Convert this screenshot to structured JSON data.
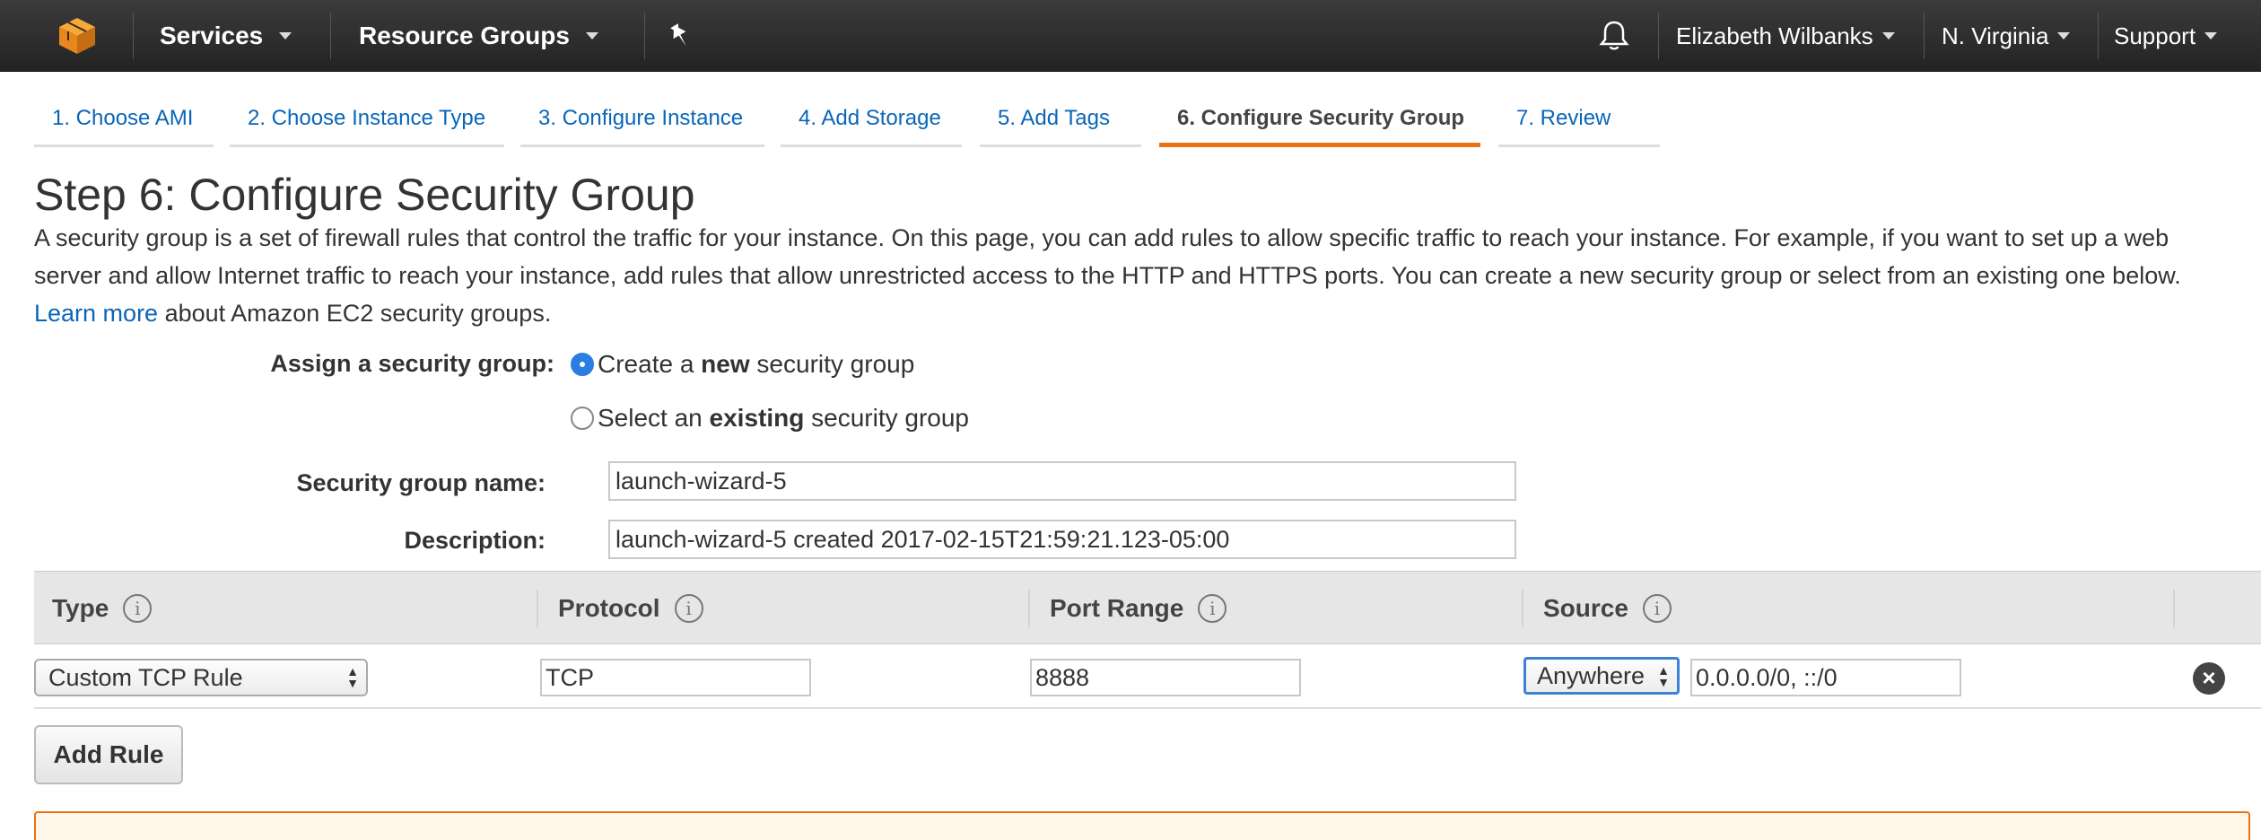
{
  "nav": {
    "services": "Services",
    "resource_groups": "Resource Groups",
    "user": "Elizabeth Wilbanks",
    "region": "N. Virginia",
    "support": "Support"
  },
  "tabs": [
    {
      "label": "1. Choose AMI"
    },
    {
      "label": "2. Choose Instance Type"
    },
    {
      "label": "3. Configure Instance"
    },
    {
      "label": "4. Add Storage"
    },
    {
      "label": "5. Add Tags"
    },
    {
      "label": "6. Configure Security Group",
      "active": true
    },
    {
      "label": "7. Review"
    }
  ],
  "page": {
    "title": "Step 6: Configure Security Group",
    "intro_text": "A security group is a set of firewall rules that control the traffic for your instance. On this page, you can add rules to allow specific traffic to reach your instance. For example, if you want to set up a web server and allow Internet traffic to reach your instance, add rules that allow unrestricted access to the HTTP and HTTPS ports. You can create a new security group or select from an existing one below.",
    "learn_more": "Learn more",
    "intro_suffix": "about Amazon EC2 security groups."
  },
  "form": {
    "assign_label": "Assign a security group:",
    "option_new_prefix": "Create a ",
    "option_new_bold": "new",
    "option_new_suffix": " security group",
    "option_existing_prefix": "Select an ",
    "option_existing_bold": "existing",
    "option_existing_suffix": " security group",
    "name_label": "Security group name:",
    "name_value": "launch-wizard-5",
    "desc_label": "Description:",
    "desc_value": "launch-wizard-5 created 2017-02-15T21:59:21.123-05:00"
  },
  "table": {
    "headers": [
      "Type",
      "Protocol",
      "Port Range",
      "Source"
    ],
    "rows": [
      {
        "type": "Custom TCP Rule",
        "protocol": "TCP",
        "port_range": "8888",
        "source_select": "Anywhere",
        "source_value": "0.0.0.0/0, ::/0"
      }
    ],
    "add_rule": "Add Rule"
  },
  "icons": {
    "info": "i",
    "remove": "×"
  }
}
